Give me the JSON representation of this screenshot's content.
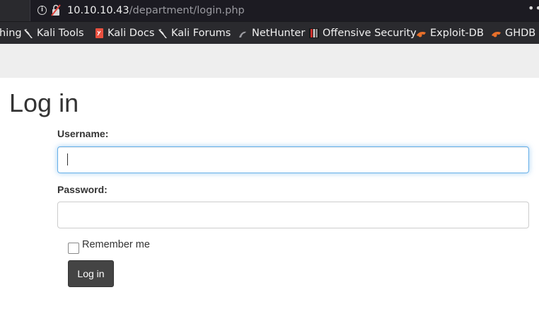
{
  "browser": {
    "url_host": "10.10.10.43",
    "url_path": "/department/login.php",
    "menu_glyph": "•••"
  },
  "bookmarks": [
    {
      "label": "hing",
      "icon": "none"
    },
    {
      "label": "Kali Tools",
      "icon": "kali-dragon-icon"
    },
    {
      "label": "Kali Docs",
      "icon": "kali-docs-icon"
    },
    {
      "label": "Kali Forums",
      "icon": "kali-dragon-icon"
    },
    {
      "label": "NetHunter",
      "icon": "nethunter-icon"
    },
    {
      "label": "Offensive Security",
      "icon": "offsec-icon"
    },
    {
      "label": "Exploit-DB",
      "icon": "exploit-db-icon"
    },
    {
      "label": "GHDB",
      "icon": "ghdb-icon"
    }
  ],
  "login": {
    "title": "Log in",
    "username_label": "Username:",
    "username_value": "",
    "password_label": "Password:",
    "password_value": "",
    "remember_label": "Remember me",
    "remember_checked": false,
    "submit_label": "Log in"
  },
  "colors": {
    "chrome_bg": "#2a2a2e",
    "page_band": "#eeeeee",
    "focus_border": "#66afe9",
    "button_bg": "#444444"
  }
}
